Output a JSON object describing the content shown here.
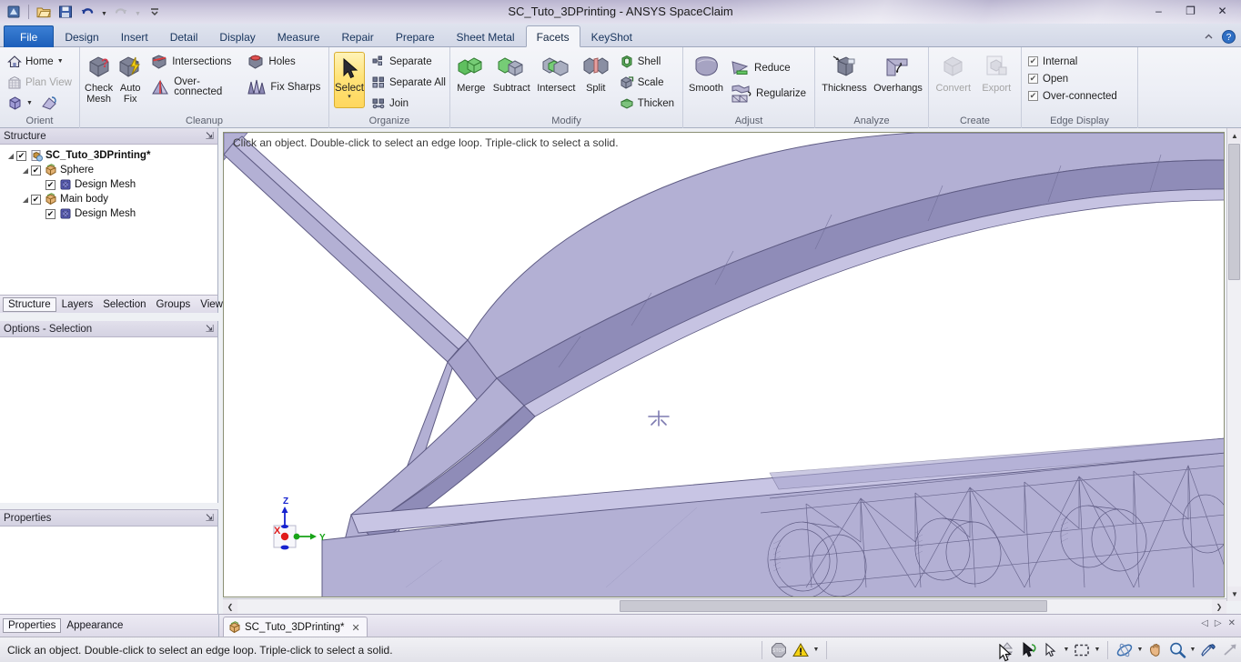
{
  "window": {
    "title": "SC_Tuto_3DPrinting - ANSYS SpaceClaim",
    "minimize": "–",
    "restore": "❐",
    "close": "✕"
  },
  "quick_access": {
    "items": [
      {
        "name": "app-menu-icon",
        "glyph": "◩"
      },
      {
        "name": "open-icon",
        "glyph": "📂"
      },
      {
        "name": "save-icon",
        "glyph": "💾"
      },
      {
        "name": "undo-icon",
        "glyph": "↶"
      },
      {
        "name": "redo-icon",
        "glyph": "↷"
      },
      {
        "name": "customize-qat-icon",
        "glyph": "⌄"
      }
    ]
  },
  "ribbon_tabs": [
    {
      "label": "File",
      "kind": "file"
    },
    {
      "label": "Design",
      "kind": "normal"
    },
    {
      "label": "Insert",
      "kind": "normal"
    },
    {
      "label": "Detail",
      "kind": "normal"
    },
    {
      "label": "Display",
      "kind": "normal"
    },
    {
      "label": "Measure",
      "kind": "normal"
    },
    {
      "label": "Repair",
      "kind": "normal"
    },
    {
      "label": "Prepare",
      "kind": "normal"
    },
    {
      "label": "Sheet Metal",
      "kind": "normal"
    },
    {
      "label": "Facets",
      "kind": "active"
    },
    {
      "label": "KeyShot",
      "kind": "normal"
    }
  ],
  "ribbon_right_icons": [
    {
      "name": "minimize-ribbon-icon",
      "glyph": "⌃"
    },
    {
      "name": "help-icon",
      "glyph": "?"
    }
  ],
  "ribbon_groups": [
    {
      "title": "Orient",
      "id": "orient",
      "small_buttons": [
        {
          "label": "Home",
          "icon": "home-icon",
          "has_arrow": true,
          "disabled": false
        },
        {
          "label": "Plan View",
          "icon": "plan-view-icon",
          "has_arrow": false,
          "disabled": true
        },
        {
          "label": "",
          "icon": "view-orient-icon",
          "has_arrow": true,
          "disabled": false
        }
      ]
    },
    {
      "title": "Cleanup",
      "id": "cleanup",
      "big_buttons": [
        {
          "label": "Check\nMesh",
          "icon": "check-mesh-icon"
        },
        {
          "label": "Auto\nFix",
          "icon": "auto-fix-icon"
        }
      ],
      "small_buttons": [
        {
          "label": "Intersections",
          "icon": "intersections-icon"
        },
        {
          "label": "Over-connected",
          "icon": "over-connected-icon"
        }
      ],
      "small_buttons_2": [
        {
          "label": "Holes",
          "icon": "holes-icon"
        },
        {
          "label": "Fix Sharps",
          "icon": "fix-sharps-icon"
        }
      ]
    },
    {
      "title": "Organize",
      "id": "organize",
      "select_button": {
        "label": "Select",
        "icon": "cursor-arrow-icon",
        "caret": "▾"
      },
      "small_buttons": [
        {
          "label": "Separate",
          "icon": "separate-icon"
        },
        {
          "label": "Separate All",
          "icon": "separate-all-icon"
        },
        {
          "label": "Join",
          "icon": "join-icon"
        }
      ]
    },
    {
      "title": "Modify",
      "id": "modify",
      "big_buttons": [
        {
          "label": "Merge",
          "icon": "merge-icon"
        },
        {
          "label": "Subtract",
          "icon": "subtract-icon"
        },
        {
          "label": "Intersect",
          "icon": "intersect-icon"
        },
        {
          "label": "Split",
          "icon": "split-icon"
        }
      ],
      "small_buttons": [
        {
          "label": "Shell",
          "icon": "shell-icon"
        },
        {
          "label": "Scale",
          "icon": "scale-icon"
        },
        {
          "label": "Thicken",
          "icon": "thicken-icon"
        }
      ]
    },
    {
      "title": "Adjust",
      "id": "adjust",
      "big_buttons": [
        {
          "label": "Smooth",
          "icon": "smooth-icon"
        }
      ],
      "small_buttons": [
        {
          "label": "Reduce",
          "icon": "reduce-icon"
        },
        {
          "label": "Regularize",
          "icon": "regularize-icon"
        }
      ]
    },
    {
      "title": "Analyze",
      "id": "analyze",
      "big_buttons": [
        {
          "label": "Thickness",
          "icon": "thickness-icon"
        },
        {
          "label": "Overhangs",
          "icon": "overhangs-icon"
        }
      ]
    },
    {
      "title": "Create",
      "id": "create",
      "big_buttons": [
        {
          "label": "Convert",
          "icon": "convert-icon",
          "disabled": true
        },
        {
          "label": "Export",
          "icon": "export-icon",
          "disabled": true
        }
      ]
    },
    {
      "title": "Edge Display",
      "id": "edge-display",
      "checkboxes": [
        {
          "label": "Internal",
          "checked": true
        },
        {
          "label": "Open",
          "checked": true
        },
        {
          "label": "Over-connected",
          "checked": true
        }
      ]
    }
  ],
  "structure_panel": {
    "title": "Structure",
    "pin": "⇲",
    "tree": [
      {
        "label": "SC_Tuto_3DPrinting*",
        "indent": 0,
        "checked": true,
        "expander": "◢",
        "bold": true,
        "icon": "document-icon"
      },
      {
        "label": "Sphere",
        "indent": 1,
        "checked": true,
        "expander": "◢",
        "bold": false,
        "icon": "body-icon"
      },
      {
        "label": "Design Mesh",
        "indent": 2,
        "checked": true,
        "expander": "",
        "bold": false,
        "icon": "mesh-icon"
      },
      {
        "label": "Main body",
        "indent": 1,
        "checked": true,
        "expander": "◢",
        "bold": false,
        "icon": "body-icon"
      },
      {
        "label": "Design Mesh",
        "indent": 2,
        "checked": true,
        "expander": "",
        "bold": false,
        "icon": "mesh-icon"
      }
    ]
  },
  "structure_tabs": [
    {
      "label": "Structure",
      "active": true
    },
    {
      "label": "Layers",
      "active": false
    },
    {
      "label": "Selection",
      "active": false
    },
    {
      "label": "Groups",
      "active": false
    },
    {
      "label": "Views",
      "active": false
    }
  ],
  "options_panel": {
    "title": "Options - Selection",
    "pin": "⇲"
  },
  "properties_panel": {
    "title": "Properties",
    "pin": "⇲"
  },
  "bottom_tabs": [
    {
      "label": "Properties",
      "active": true
    },
    {
      "label": "Appearance",
      "active": false
    }
  ],
  "viewport": {
    "hint": "Click an object. Double-click to select an edge loop. Triple-click to select a solid.",
    "model_fill": "#b3b0d4",
    "model_edge": "#5f5c84",
    "background": "#ffffff",
    "axis_triad": {
      "x_label": "X",
      "x_color": "#e01b1b",
      "y_label": "Y",
      "y_color": "#17a317",
      "z_label": "Z",
      "z_color": "#1622cf"
    },
    "scroll_left_arrow": "❮",
    "scroll_right_arrow": "❯",
    "scroll_up_arrow": "▲",
    "scroll_down_arrow": "▼"
  },
  "document_tab": {
    "label": "SC_Tuto_3DPrinting*",
    "close": "✕",
    "icon": "body-icon",
    "nav_prev": "◁",
    "nav_next": "▷",
    "nav_close": "✕"
  },
  "statusbar": {
    "message": "Click an object. Double-click to select an edge loop. Triple-click to select a solid.",
    "icons": [
      {
        "name": "stop-recording-icon",
        "glyph": "STOP",
        "caret": false
      },
      {
        "name": "warning-icon",
        "glyph": "⚠",
        "caret": true
      },
      {
        "name": "spin-updown-icon",
        "glyph": "⇅",
        "caret": false
      },
      {
        "name": "select-pointer-icon",
        "glyph": "➤",
        "caret": false
      },
      {
        "name": "cursor-arrow-icon",
        "glyph": "↖",
        "caret": true
      },
      {
        "name": "box-select-icon",
        "glyph": "⬚",
        "caret": true
      },
      {
        "name": "orbit-icon",
        "glyph": "◯",
        "caret": true
      },
      {
        "name": "pan-hand-icon",
        "glyph": "✋",
        "caret": false
      },
      {
        "name": "zoom-icon",
        "glyph": "🔍",
        "caret": true
      },
      {
        "name": "eyedropper-icon",
        "glyph": "✒",
        "caret": false
      },
      {
        "name": "fit-arrow-icon",
        "glyph": "↗",
        "caret": false
      }
    ]
  }
}
